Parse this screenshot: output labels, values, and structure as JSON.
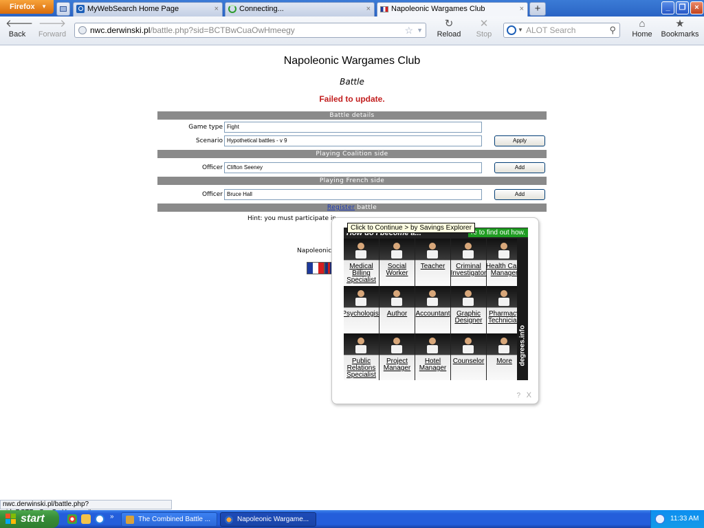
{
  "browser": {
    "menu_button": "Firefox",
    "tabs": [
      {
        "title": "MyWebSearch Home Page",
        "icon": "search-favicon"
      },
      {
        "title": "Connecting...",
        "icon": "loading-spinner-icon"
      },
      {
        "title": "Napoleonic Wargames Club",
        "icon": "french-flag-favicon"
      }
    ],
    "nav": {
      "back": "Back",
      "forward": "Forward",
      "reload": "Reload",
      "stop": "Stop",
      "home": "Home",
      "bookmarks": "Bookmarks"
    },
    "url_host": "nwc.derwinski.pl",
    "url_path": "/battle.php?sid=BCTBwCuaOwHmeegy",
    "search_placeholder": "ALOT Search",
    "status_text": "nwc.derwinski.pl/battle.php?sid=BCTBwCuaOwHmeegy#"
  },
  "page": {
    "site_title": "Napoleonic Wargames Club",
    "subtitle": "Battle",
    "error": "Failed to update.",
    "sections": {
      "details": "Battle details",
      "coalition": "Playing Coalition side",
      "french": "Playing French side"
    },
    "game_type_label": "Game type",
    "game_type_value": "Fight",
    "scenario_label": "Scenario",
    "scenario_value": "Hypothetical battles - v 9",
    "apply_label": "Apply",
    "coalition_officer_label": "Officer",
    "coalition_officer_value": "Clifton Seeney",
    "french_officer_label": "Officer",
    "french_officer_value": "Bruce Hall",
    "add_label": "Add",
    "register_link": "Register",
    "register_suffix": " battle",
    "hint": "Hint: you must participate in",
    "footer_text": "Napoleonic"
  },
  "ad": {
    "tooltip": "Click to Continue > by Savings Explorer",
    "headline": "How do I become a...",
    "cta": "re to find out how.",
    "side_brand": "degrees.info",
    "help": "?",
    "close": "X",
    "careers": [
      [
        "Medical Billing Specialist",
        "Social Worker",
        "Teacher",
        "Criminal Investigator",
        "Health Care Manager"
      ],
      [
        "Psychologist",
        "Author",
        "Accountant",
        "Graphic Designer",
        "Pharmacy Technician"
      ],
      [
        "Public Relations Specialist",
        "Project Manager",
        "Hotel Manager",
        "Counselor",
        "More"
      ]
    ]
  },
  "taskbar": {
    "start": "start",
    "tasks": [
      "The Combined Battle ...",
      "Napoleonic Wargame..."
    ],
    "clock": "11:33 AM"
  },
  "colors": {
    "error_red": "#c21d1d",
    "section_gray": "#8a8a8a",
    "link_blue": "#1a37b7",
    "ad_green": "#1f9d22",
    "taskbar_blue": "#245edb"
  }
}
